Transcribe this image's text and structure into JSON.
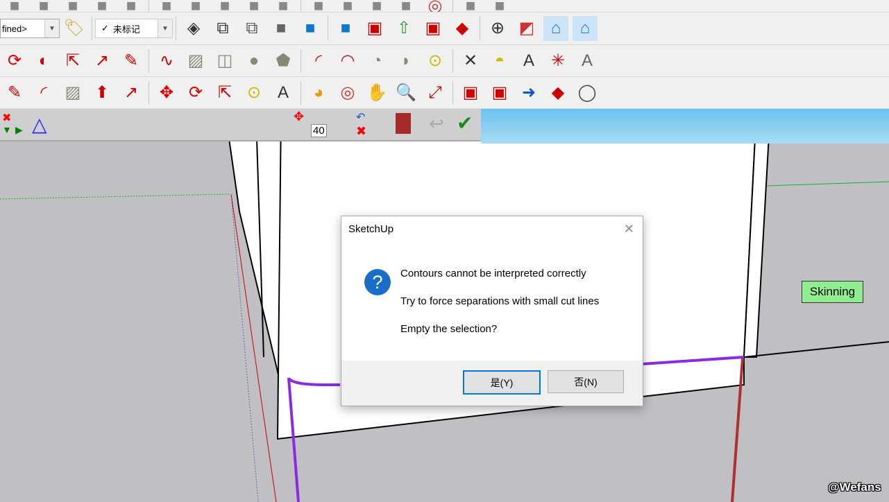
{
  "toolbars": {
    "row1": [
      "save",
      "scissors",
      "paint",
      "copy",
      "delete",
      "undo",
      "redo",
      "print",
      "info",
      "map",
      "eraser",
      "box-yellow",
      "box-blue",
      "box-green",
      "orbit",
      "walk-person",
      "xray-cube"
    ],
    "row2_before": [
      "tag-icon"
    ],
    "row2_after": [
      "iso-view",
      "wire",
      "hidden",
      "shaded",
      "textured",
      "mono",
      "warehouse",
      "upload",
      "extension",
      "ruby",
      "section-plane",
      "section-fill",
      "house-blue",
      "house-selected"
    ],
    "row3": [
      "rotate",
      "follow-me",
      "scale",
      "offset",
      "pencil",
      "freehand",
      "rectangle",
      "rotated-rect",
      "circle",
      "polygon",
      "arc",
      "arc-2pt",
      "pie",
      "pie-3pt",
      "tape-measure",
      "dimension",
      "protractor",
      "text",
      "axes",
      "3d-text"
    ],
    "row4": [
      "pencil",
      "arc",
      "rectangle",
      "push-pull",
      "offset",
      "move",
      "rotate",
      "scale",
      "tape-measure",
      "text",
      "paint-bucket",
      "orbit",
      "pan",
      "zoom",
      "zoom-extents",
      "warehouse",
      "extension",
      "send",
      "ruby",
      "account"
    ]
  },
  "style_combo": {
    "value": "fined>"
  },
  "tag_combo": {
    "check": "✓",
    "value": "未标记"
  },
  "aux_toolbar": {
    "value": "40"
  },
  "dialog": {
    "title": "SketchUp",
    "close": "✕",
    "icon": "?",
    "lines": [
      "Contours cannot be interpreted correctly",
      "Try to force separations with small cut lines",
      "Empty the selection?"
    ],
    "yes": "是(Y)",
    "no": "否(N)"
  },
  "label": "Skinning",
  "watermark": "@Wefans"
}
